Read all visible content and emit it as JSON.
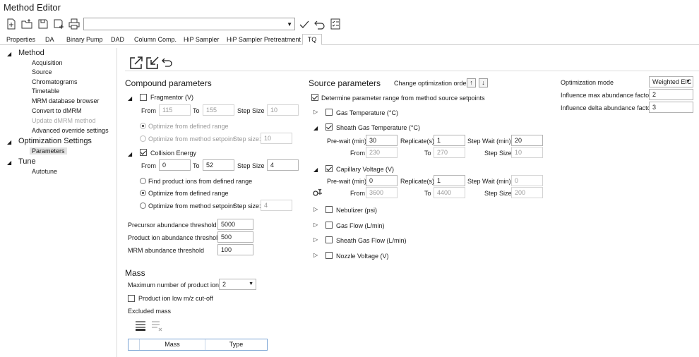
{
  "app": {
    "title": "Method Editor"
  },
  "toolbar": {
    "icons": [
      "new-file-icon",
      "open-folder-icon",
      "save-icon",
      "save-as-icon",
      "print-icon",
      "checkmark-icon",
      "undo-icon",
      "checklist-icon"
    ],
    "combo_value": ""
  },
  "tabs": [
    {
      "label": "Properties"
    },
    {
      "label": "DA"
    },
    {
      "label": "Binary Pump"
    },
    {
      "label": "DAD"
    },
    {
      "label": "Column Comp."
    },
    {
      "label": "HiP Sampler"
    },
    {
      "label": "HiP Sampler Pretreatment"
    },
    {
      "label": "TQ",
      "active": true
    }
  ],
  "tree": {
    "method": {
      "label": "Method",
      "children": [
        "Acquisition",
        "Source",
        "Chromatograms",
        "Timetable",
        "MRM database browser",
        "Convert to dMRM",
        "Update dMRM method",
        "Advanced override settings"
      ]
    },
    "optimization": {
      "label": "Optimization Settings",
      "children": [
        "Parameters"
      ]
    },
    "tune": {
      "label": "Tune",
      "children": [
        "Autotune"
      ]
    }
  },
  "compound": {
    "title": "Compound parameters",
    "fragmentor": {
      "label": "Fragmentor (V)",
      "checked": false,
      "from_label": "From",
      "from": "115",
      "to_label": "To",
      "to": "155",
      "step_label": "Step Size",
      "step": "10",
      "opt1": "Optimize from defined range",
      "opt2": "Optimize from method setpoint",
      "step2_label": "Step size:",
      "step2": "10"
    },
    "collision": {
      "label": "Collision Energy",
      "checked": true,
      "from_label": "From",
      "from": "0",
      "to_label": "To",
      "to": "52",
      "step_label": "Step Size",
      "step": "4",
      "opt1": "Find product ions from defined range",
      "opt2": "Optimize from defined range",
      "opt3": "Optimize from method setpoint",
      "step3_label": "Step size:",
      "step3": "4"
    },
    "precursor_label": "Precursor abundance threshold",
    "precursor": "5000",
    "product_label": "Product ion abundance threshold",
    "product": "500",
    "mrm_label": "MRM abundance threshold",
    "mrm": "100"
  },
  "mass": {
    "title": "Mass",
    "max_label": "Maximum number of product ions",
    "max_value": "2",
    "cutoff_label": "Product ion low m/z cut-off",
    "excluded_label": "Excluded mass",
    "grid_columns": [
      "Mass",
      "Type"
    ]
  },
  "source": {
    "title": "Source parameters",
    "change_order_label": "Change optimization order",
    "determine_label": "Determine parameter range from method source setpoints",
    "gas_temp": "Gas Temperature (°C)",
    "sheath_temp": {
      "label": "Sheath Gas Temperature (°C)",
      "prewait_label": "Pre-wait (min)",
      "prewait": "30",
      "replicate_label": "Replicate(s)",
      "replicate": "1",
      "stepwait_label": "Step Wait (min)",
      "stepwait": "20",
      "from_label": "From",
      "from": "230",
      "to_label": "To",
      "to": "270",
      "step_label": "Step Size",
      "step": "10"
    },
    "capillary": {
      "label": "Capillary Voltage (V)",
      "prewait_label": "Pre-wait (min)",
      "prewait": "0",
      "replicate_label": "Replicate(s)",
      "replicate": "1",
      "stepwait_label": "Step Wait (min)",
      "stepwait": "0",
      "from_label": "From",
      "from": "3600",
      "to_label": "To",
      "to": "4400",
      "step_label": "Step Size",
      "step": "200"
    },
    "nebulizer": "Nebulizer (psi)",
    "gas_flow": "Gas Flow (L/min)",
    "sheath_flow": "Sheath Gas Flow (L/min)",
    "nozzle": "Nozzle Voltage (V)"
  },
  "optimization": {
    "mode_label": "Optimization mode",
    "mode": "Weighted EIC",
    "max_factor_label": "Influence max abundance factor",
    "max_factor": "2",
    "delta_factor_label": "Influence delta abundance factor",
    "delta_factor": "3"
  }
}
